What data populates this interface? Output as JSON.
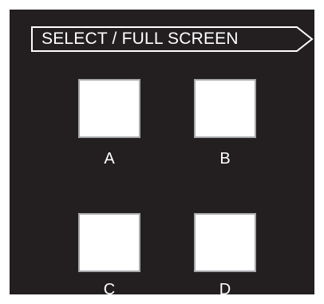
{
  "header": {
    "label": "SELECT / FULL SCREEN",
    "icon": "arrow-tag-outline"
  },
  "buttons": [
    {
      "label": "A"
    },
    {
      "label": "B"
    },
    {
      "label": "C"
    },
    {
      "label": "D"
    }
  ],
  "colors": {
    "panel_background": "#231f20",
    "button_fill": "#ffffff",
    "button_border": "#a7a9ac",
    "text": "#ffffff"
  }
}
